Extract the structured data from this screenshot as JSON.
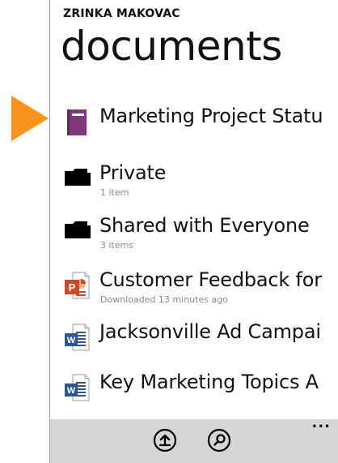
{
  "header": {
    "account_name": "ZRINKA MAKOVAC",
    "title": "documents"
  },
  "items": [
    {
      "title": "Marketing Project Statu",
      "subtitle": "",
      "icon": "onenote-notebook-icon"
    },
    {
      "title": "Private",
      "subtitle": "1 item",
      "icon": "folder-icon"
    },
    {
      "title": "Shared with Everyone",
      "subtitle": "3 items",
      "icon": "folder-icon"
    },
    {
      "title": "Customer Feedback for",
      "subtitle": "Downloaded 13 minutes ago",
      "icon": "powerpoint-file-icon"
    },
    {
      "title": "Jacksonville Ad Campai",
      "subtitle": "",
      "icon": "word-file-icon"
    },
    {
      "title": "Key Marketing Topics A",
      "subtitle": "",
      "icon": "word-file-icon"
    }
  ],
  "appbar": {
    "buttons": [
      {
        "icon": "upload-icon"
      },
      {
        "icon": "search-icon"
      }
    ],
    "more_label": "..."
  },
  "colors": {
    "pointer": "#f7931e",
    "onenote": "#80397b",
    "powerpoint": "#d24726",
    "word": "#2b579a",
    "appbar": "#d6d6d6"
  }
}
